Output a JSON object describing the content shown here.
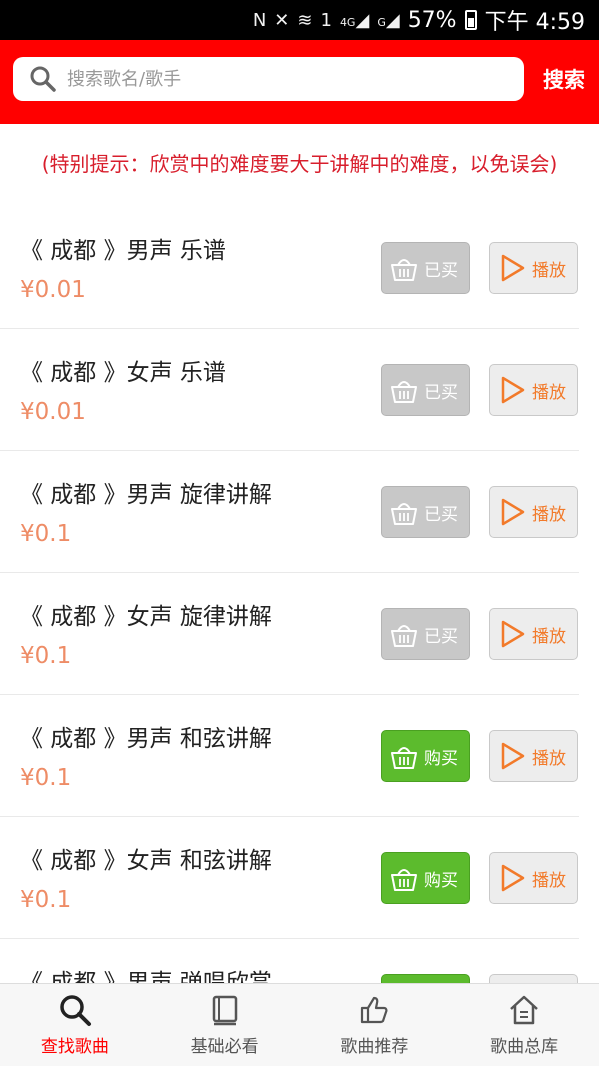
{
  "status_bar": {
    "icons": [
      "nfc-icon",
      "mute-icon",
      "wifi-icon",
      "sim1-icon",
      "signal-4g-icon",
      "signal-g-icon",
      "battery-icon"
    ],
    "sim_label": "1",
    "net_4g": "4G",
    "net_g": "G",
    "battery": "57%",
    "time": "下午 4:59"
  },
  "search": {
    "placeholder": "搜索歌名/歌手",
    "button_label": "搜索"
  },
  "notice": "(特别提示：欣赏中的难度要大于讲解中的难度，以免误会)",
  "songs": [
    {
      "title": "《 成都 》男声 乐谱",
      "price": "¥0.01",
      "buy_label": "已买",
      "buy_state": "bought",
      "play_label": "播放"
    },
    {
      "title": "《 成都 》女声 乐谱",
      "price": "¥0.01",
      "buy_label": "已买",
      "buy_state": "bought",
      "play_label": "播放"
    },
    {
      "title": "《 成都 》男声 旋律讲解",
      "price": "¥0.1",
      "buy_label": "已买",
      "buy_state": "bought",
      "play_label": "播放"
    },
    {
      "title": "《 成都 》女声 旋律讲解",
      "price": "¥0.1",
      "buy_label": "已买",
      "buy_state": "bought",
      "play_label": "播放"
    },
    {
      "title": "《 成都 》男声 和弦讲解",
      "price": "¥0.1",
      "buy_label": "购买",
      "buy_state": "available",
      "play_label": "播放"
    },
    {
      "title": "《 成都 》女声 和弦讲解",
      "price": "¥0.1",
      "buy_label": "购买",
      "buy_state": "available",
      "play_label": "播放"
    },
    {
      "title": "《 成都 》男声 弹唱欣赏",
      "price": "",
      "buy_label": "",
      "buy_state": "available",
      "play_label": ""
    }
  ],
  "tabs": [
    {
      "label": "查找歌曲",
      "icon": "search-icon",
      "active": true
    },
    {
      "label": "基础必看",
      "icon": "book-icon",
      "active": false
    },
    {
      "label": "歌曲推荐",
      "icon": "thumbs-up-icon",
      "active": false
    },
    {
      "label": "歌曲总库",
      "icon": "home-icon",
      "active": false
    }
  ],
  "colors": {
    "header": "#ff0000",
    "price": "#ee8c66",
    "bought_button": "#c8c8c8",
    "buy_button": "#5cbb2d",
    "play_accent": "#f27a2a",
    "active_tab": "#ff0000"
  }
}
